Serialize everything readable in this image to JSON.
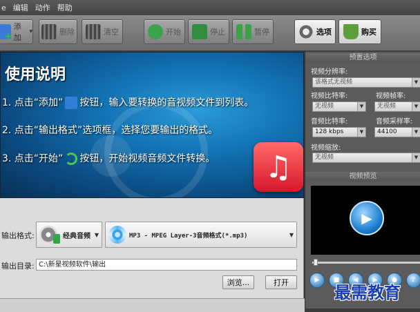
{
  "menu": {
    "items": [
      "e",
      "编辑",
      "动作",
      "帮助"
    ]
  },
  "toolbar": {
    "add": "添加",
    "delete": "删除",
    "clear": "清空",
    "start": "开始",
    "stop": "停止",
    "pause": "暂停",
    "options": "选项",
    "buy": "购买"
  },
  "banner": {
    "title": "使用说明",
    "step1_a": "1. 点击“添加”",
    "step1_b": "按钮，输入要转换的音视频文件到列表。",
    "step2": "2. 点击“输出格式”选项框，选择您要输出的格式。",
    "step3_a": "3. 点击“开始”",
    "step3_b": "按钮，开始视频音频文件转换。"
  },
  "output": {
    "format_label": "输出格式:",
    "category": "经典音频",
    "format": "MP3 - MPEG Layer-3音频格式(*.mp3)",
    "dir_label": "输出目录:",
    "dir_value": "C:\\新星视频软件\\输出",
    "browse": "浏览...",
    "open": "打开"
  },
  "preset": {
    "header": "预置选项",
    "resolution_label": "视频分辨率:",
    "resolution_value": "该格式无视频",
    "video_bitrate_label": "视频比特率:",
    "video_bitrate_value": "无视频",
    "framerate_label": "视频帧率:",
    "framerate_value": "无视频",
    "audio_bitrate_label": "音频比特率:",
    "audio_bitrate_value": "128 kbps",
    "samplerate_label": "音频采样率:",
    "samplerate_value": "44100",
    "scale_label": "视频缩放:",
    "scale_value": "无视频"
  },
  "preview": {
    "header": "视频预览"
  },
  "watermark": "最需教育",
  "colors": {
    "banner_blue": "#1272b3",
    "watermark_blue": "#1a3fb0"
  }
}
